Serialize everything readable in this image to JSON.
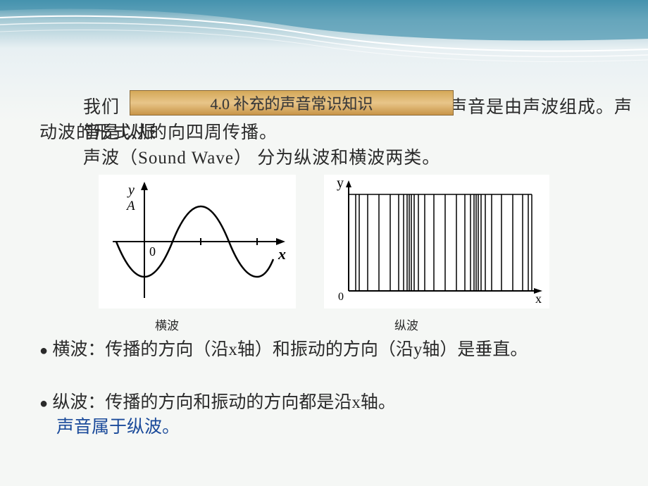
{
  "title_banner": "4.0 补充的声音常识知识",
  "paragraph": {
    "line1_before": "我们",
    "line1_after": "平常听到的声音是由声波组成。声音是以振",
    "line2": "动波的形式从的向四周传播。",
    "line3": "声波（Sound Wave） 分为纵波和横波两类。"
  },
  "captions": {
    "transverse": "横波",
    "longitudinal": "纵波"
  },
  "bullets": {
    "bullet_symbol": "●",
    "transverse_def": " 横波：传播的方向（沿x轴）和振动的方向（沿y轴）是垂直。",
    "longitudinal_def": " 纵波：传播的方向和振动的方向都是沿x轴。"
  },
  "conclusion": "声音属于纵波。",
  "axis_labels": {
    "y1": "y",
    "a": "A",
    "zero1": "0",
    "x1": "x",
    "y2": "y",
    "zero2": "0",
    "x2": "x"
  }
}
